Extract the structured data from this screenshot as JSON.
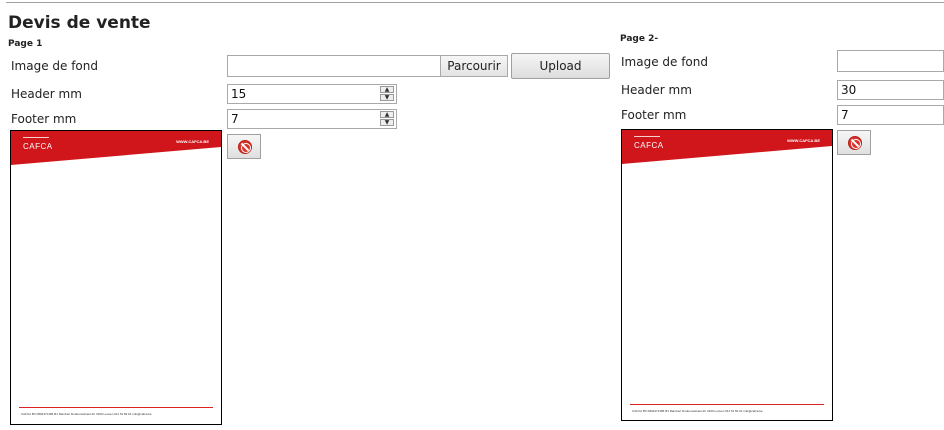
{
  "title": "Devis de vente",
  "colors": {
    "accent_red": "#d0161b",
    "border": "#a9a9a9"
  },
  "pages": [
    {
      "label": "Page 1",
      "image_label": "Image de fond",
      "image_value": "",
      "browse_label": "Parcourir",
      "upload_label": "Upload",
      "header_label": "Header mm",
      "header_value": "15",
      "footer_label": "Footer mm",
      "footer_value": "7",
      "delete_icon": "delete-icon",
      "preview": {
        "brand": "CAFCA",
        "website": "WWW.CAFCA.BE",
        "footer_text": "CAFCA BV 0804471486 B1   Rambert Dodoensstraat 4C 3910 Leuven   011 51 82 91   info@cafca.be"
      }
    },
    {
      "label": "Page 2-",
      "image_label": "Image de fond",
      "image_value": "",
      "header_label": "Header mm",
      "header_value": "30",
      "footer_label": "Footer mm",
      "footer_value": "7",
      "delete_icon": "delete-icon",
      "preview": {
        "brand": "CAFCA",
        "website": "WWW.CAFCA.BE",
        "footer_text": "CAFCA BV 0804471486 B1   Rambert Dodoensstraat 4C 3910 Leuven   011 51 82 91   info@cafca.be"
      }
    }
  ]
}
